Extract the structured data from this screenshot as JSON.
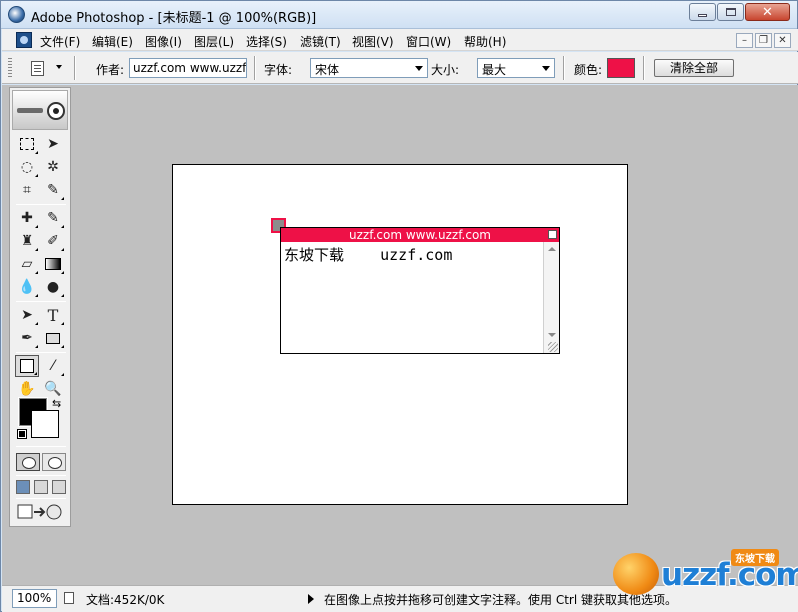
{
  "window": {
    "title": "Adobe Photoshop - [未标题-1 @ 100%(RGB)]",
    "close_glyph": "✕"
  },
  "menubar": {
    "items": [
      "文件(F)",
      "编辑(E)",
      "图像(I)",
      "图层(L)",
      "选择(S)",
      "滤镜(T)",
      "视图(V)",
      "窗口(W)",
      "帮助(H)"
    ],
    "mdi": {
      "minimize": "–",
      "restore": "❐",
      "close": "✕"
    }
  },
  "options": {
    "author_label": "作者:",
    "author_value": "uzzf.com www.uzzf.",
    "font_label": "字体:",
    "font_value": "宋体",
    "size_label": "大小:",
    "size_value": "最大",
    "color_label": "颜色:",
    "color_value": "#ee1147",
    "clear_label": "清除全部"
  },
  "toolbox": {
    "tools": [
      "marquee-icon",
      "move-icon",
      "lasso-icon",
      "magic-wand-icon",
      "crop-icon",
      "slice-icon",
      "healing-brush-icon",
      "brush-icon",
      "clone-stamp-icon",
      "history-brush-icon",
      "eraser-icon",
      "gradient-icon",
      "blur-icon",
      "dodge-icon",
      "path-selection-icon",
      "type-icon",
      "pen-icon",
      "shape-icon",
      "notes-icon",
      "eyedropper-icon",
      "hand-icon",
      "zoom-icon"
    ],
    "type_glyph": "T",
    "swap_glyph": "⇆",
    "foreground": "#000000",
    "background": "#ffffff"
  },
  "note": {
    "title": "uzzf.com www.uzzf.com",
    "body": "东坡下载    uzzf.com",
    "color": "#ee1147"
  },
  "status": {
    "zoom": "100%",
    "doc_size": "文档:452K/0K",
    "hint": "在图像上点按并拖移可创建文字注释。使用 Ctrl 键获取其他选项。"
  },
  "watermark": {
    "text": "uzzf.com",
    "badge": "东坡下载"
  }
}
